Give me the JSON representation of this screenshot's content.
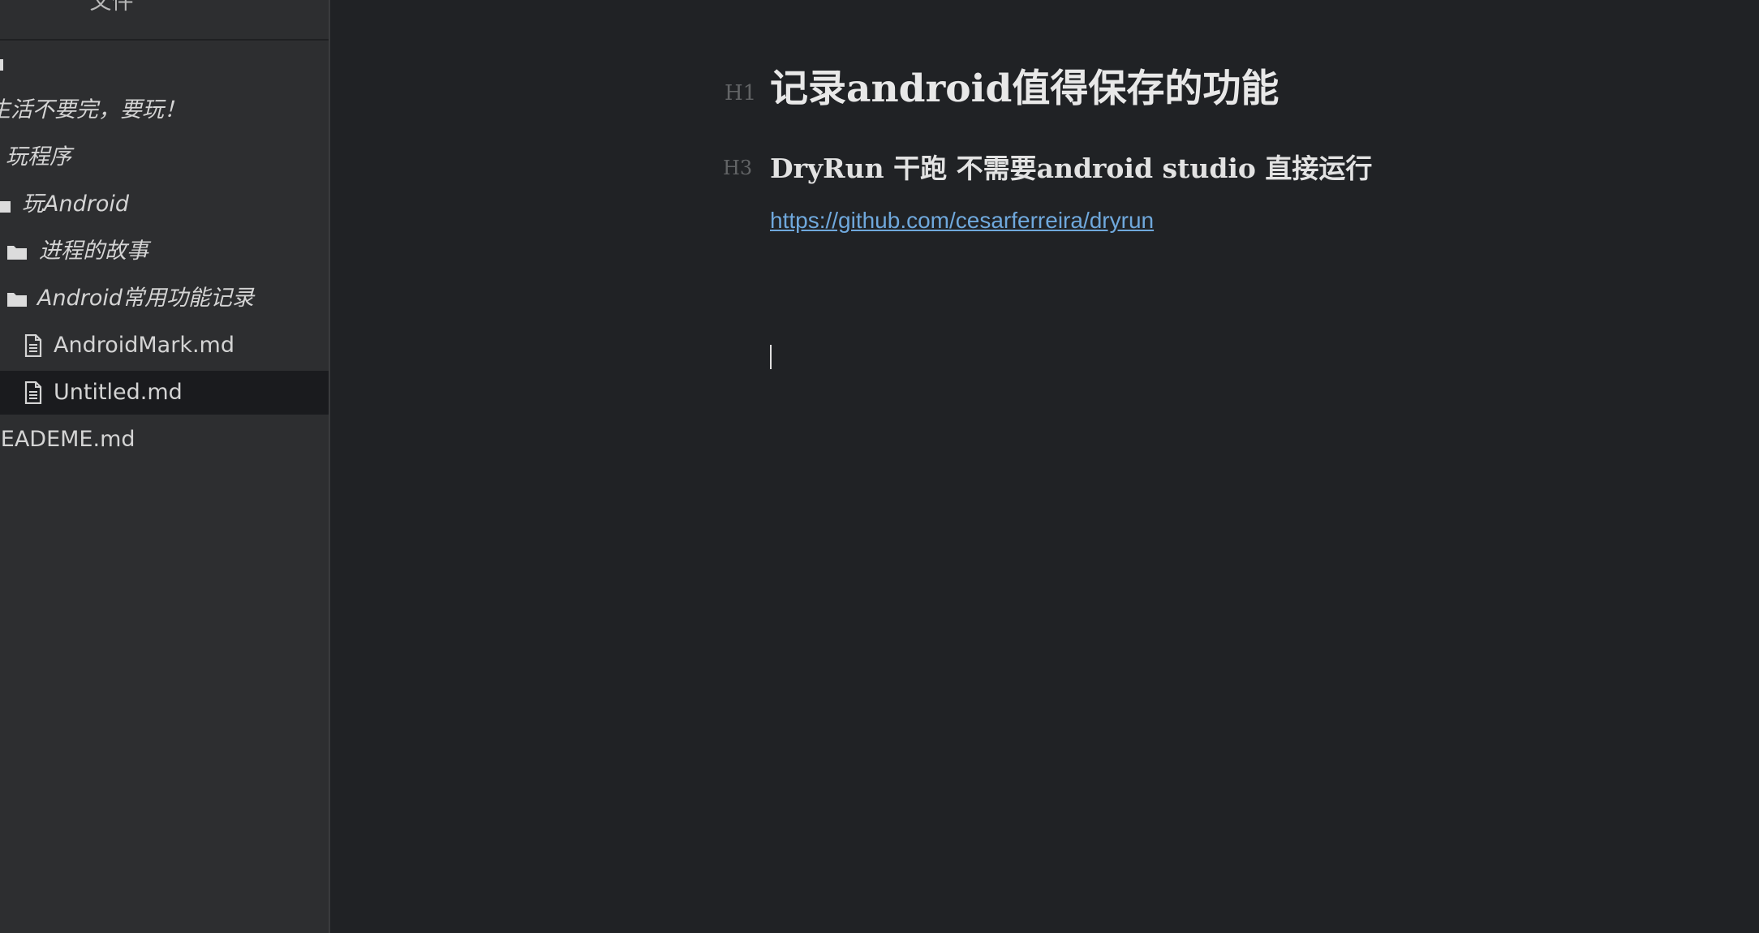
{
  "sidebar": {
    "title": "文件",
    "items": [
      {
        "label": "",
        "type": "folder"
      },
      {
        "label": "生活不要完，要玩！",
        "type": "folder"
      },
      {
        "label": "玩程序",
        "type": "folder"
      },
      {
        "label": "玩Android",
        "type": "folder"
      },
      {
        "label": "进程的故事",
        "type": "folder"
      },
      {
        "label": "Android常用功能记录",
        "type": "folder"
      },
      {
        "label": "AndroidMark.md",
        "type": "file"
      },
      {
        "label": "Untitled.md",
        "type": "file",
        "selected": true
      },
      {
        "label": "READEME.md",
        "type": "file"
      }
    ]
  },
  "editor": {
    "h1_marker": "H1",
    "title": "记录android值得保存的功能",
    "h3_marker": "H3",
    "subtitle": "DryRun 干跑 不需要android studio 直接运行",
    "link": "https://github.com/cesarferreira/dryrun"
  },
  "icons": {
    "folder": "folder-icon",
    "file": "file-icon"
  },
  "colors": {
    "sidebar_bg": "#2d2e30",
    "editor_bg": "#202225",
    "selected_row": "#1a1b1e",
    "link": "#6fa8dc"
  }
}
